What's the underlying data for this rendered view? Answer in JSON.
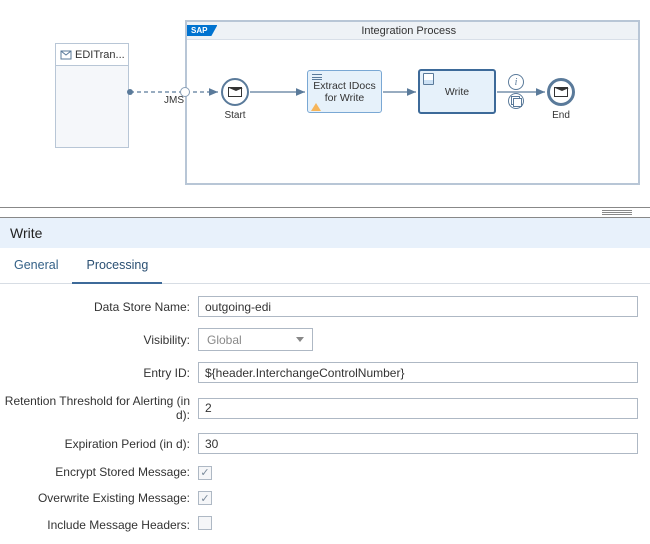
{
  "external": {
    "title": "EDITran..."
  },
  "process": {
    "logo": "SAP",
    "title": "Integration Process",
    "start_label": "Start",
    "end_label": "End",
    "extract_label": "Extract IDocs for Write",
    "write_label": "Write",
    "jms_label": "JMS"
  },
  "panel": {
    "title": "Write",
    "tabs": {
      "general": "General",
      "processing": "Processing"
    },
    "fields": {
      "data_store_name": {
        "label": "Data Store Name:",
        "value": "outgoing-edi"
      },
      "visibility": {
        "label": "Visibility:",
        "value": "Global"
      },
      "entry_id": {
        "label": "Entry ID:",
        "value": "${header.InterchangeControlNumber}"
      },
      "retention": {
        "label": "Retention Threshold for Alerting (in d):",
        "value": "2"
      },
      "expiration": {
        "label": "Expiration Period (in d):",
        "value": "30"
      },
      "encrypt": {
        "label": "Encrypt Stored Message:",
        "checked": true
      },
      "overwrite": {
        "label": "Overwrite Existing Message:",
        "checked": true
      },
      "include_headers": {
        "label": "Include Message Headers:",
        "checked": false
      }
    }
  }
}
